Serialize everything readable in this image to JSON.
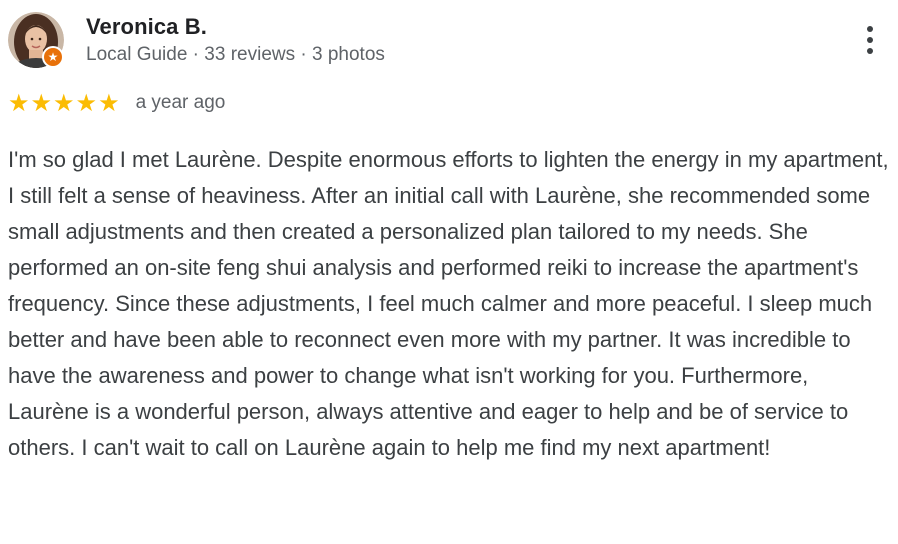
{
  "review": {
    "author": "Veronica B.",
    "author_meta": {
      "level": "Local Guide",
      "reviews": "33 reviews",
      "photos": "3 photos",
      "separator": " · "
    },
    "rating": 5,
    "rating_max": 5,
    "star_color": "#fbbc04",
    "badge_color": "#e8710a",
    "date": "a year ago",
    "text": "I'm so glad I met Laurène. Despite enormous efforts to lighten the energy in my apartment, I still felt a sense of heaviness. After an initial call with Laurène, she recommended some small adjustments and then created a personalized plan tailored to my needs. She performed an on-site feng shui analysis and performed reiki to increase the apartment's frequency. Since these adjustments, I feel much calmer and more peaceful. I sleep much better and have been able to reconnect even more with my partner. It was incredible to have the awareness and power to change what isn't working for you. Furthermore, Laurène is a wonderful person, always attentive and eager to help and be of service to others. I can't wait to call on Laurène again to help me find my next apartment!"
  }
}
